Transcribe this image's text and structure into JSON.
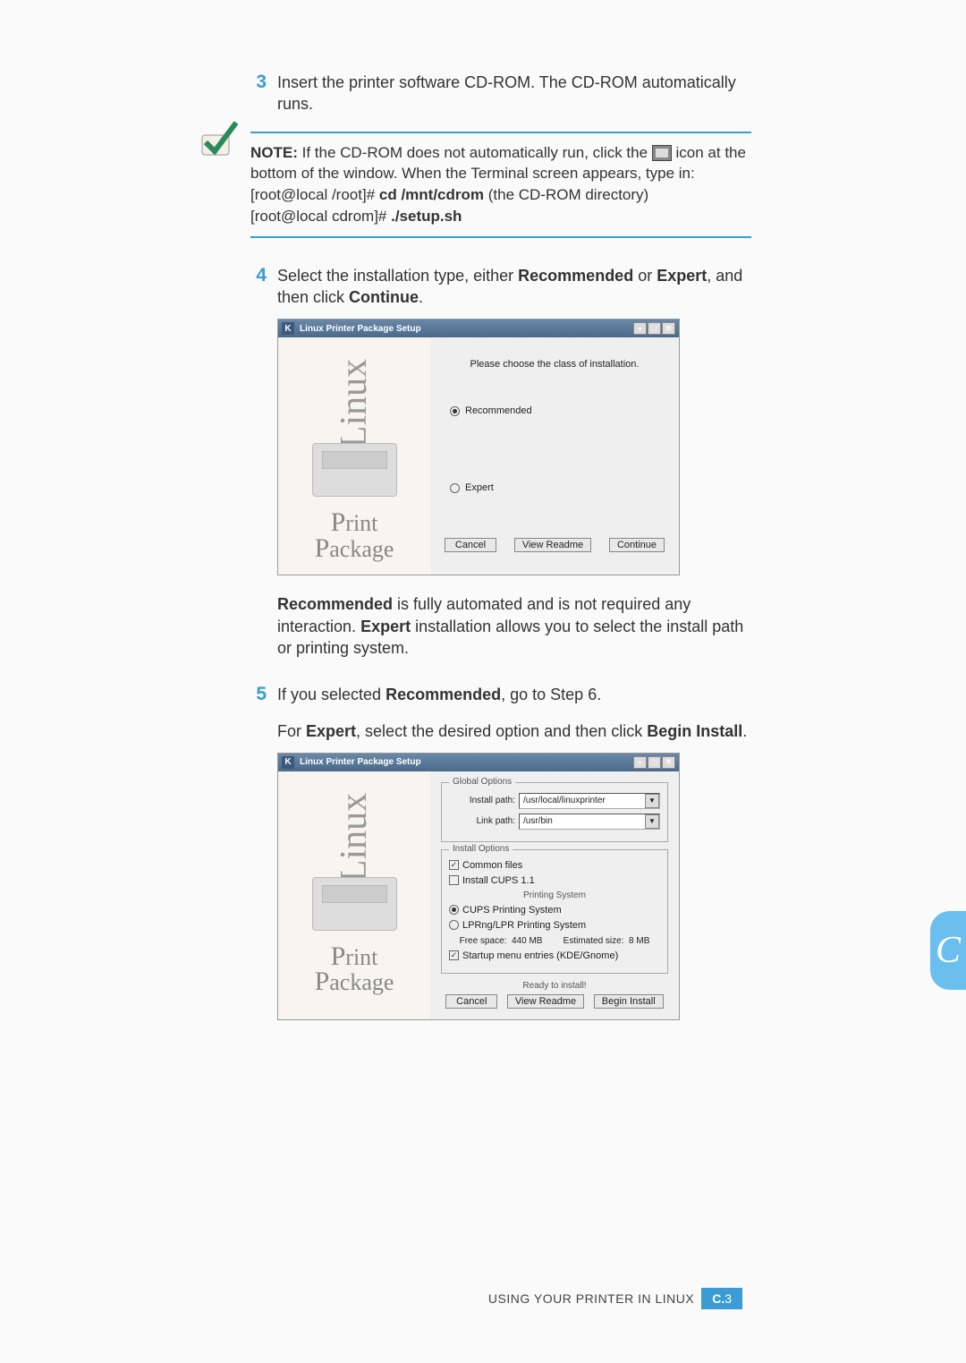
{
  "steps": {
    "s3": {
      "num": "3",
      "text_a": "Insert the printer software CD-ROM. The CD-ROM automatically runs."
    },
    "s4": {
      "num": "4",
      "text_a": "Select the installation type, either ",
      "bold_a": "Recommended",
      "mid": " or ",
      "bold_b": "Expert",
      "text_b": ", and then click ",
      "bold_c": "Continue",
      "end": "."
    },
    "s5": {
      "num": "5",
      "text_a": "If you selected ",
      "bold_a": "Recommended",
      "text_b": ", go to Step 6."
    }
  },
  "note": {
    "label": "NOTE:",
    "line1": " If the CD-ROM does not automatically run, click the ",
    "line2": "icon at the bottom of the window. When the Terminal screen appears, type in:",
    "cmd1_pre": "[root@local /root]# ",
    "cmd1": "cd /mnt/cdrom",
    "cmd1_post": " (the CD-ROM directory)",
    "cmd2_pre": "[root@local cdrom]# ",
    "cmd2": "./setup.sh"
  },
  "explain1": {
    "b1": "Recommended",
    "t1": " is fully automated and is not required any interaction. ",
    "b2": "Expert",
    "t2": " installation allows you to select the install path or printing system."
  },
  "expert_hint": {
    "t1": "For ",
    "b1": "Expert",
    "t2": ", select the desired option and then click ",
    "b2": "Begin Install",
    "t3": "."
  },
  "win1": {
    "title": "Linux Printer Package Setup",
    "header": "Please choose the class of installation.",
    "opt1": "Recommended",
    "opt2": "Expert",
    "btn_cancel": "Cancel",
    "btn_readme": "View Readme",
    "btn_continue": "Continue"
  },
  "win2": {
    "title": "Linux Printer Package Setup",
    "global": {
      "legend": "Global Options",
      "install_lbl": "Install path:",
      "install_val": "/usr/local/linuxprinter",
      "link_lbl": "Link path:",
      "link_val": "/usr/bin"
    },
    "install": {
      "legend": "Install Options",
      "common": "Common files",
      "cups11": "Install CUPS 1.1",
      "ps_header": "Printing System",
      "cups": "CUPS Printing System",
      "lpr": "LPRng/LPR Printing System",
      "free": "Free space:",
      "free_v": "440 MB",
      "est": "Estimated size:",
      "est_v": "8 MB",
      "startup": "Startup menu entries (KDE/Gnome)"
    },
    "ready": "Ready to install!",
    "btn_cancel": "Cancel",
    "btn_readme": "View Readme",
    "btn_begin": "Begin Install"
  },
  "sidebar_logo": {
    "linux": "Linux",
    "print": "Print",
    "package": "Package"
  },
  "side_tab": "C",
  "footer": {
    "text": "USING YOUR PRINTER IN LINUX",
    "page": "C.3"
  }
}
